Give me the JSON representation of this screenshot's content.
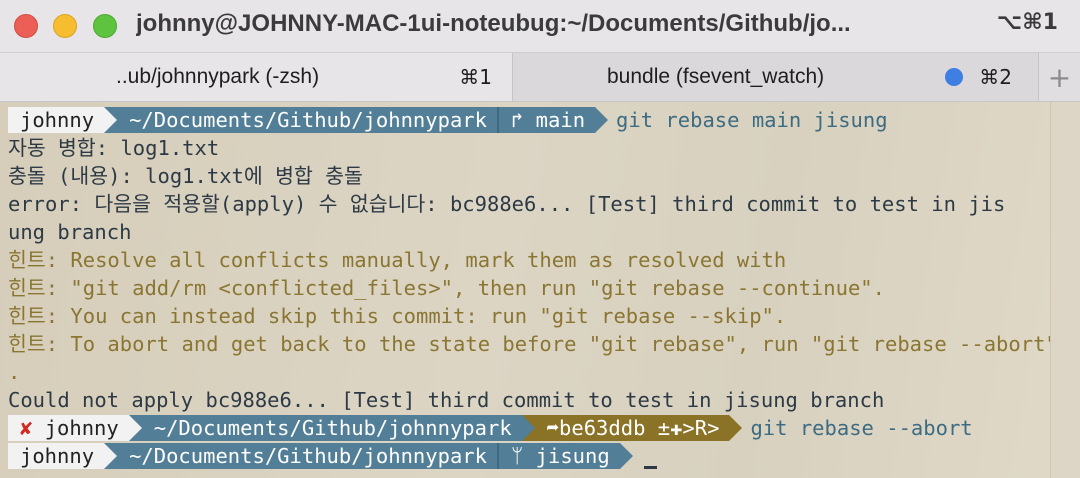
{
  "window": {
    "title": "johnny@JOHNNY-MAC-1ui-noteubug:~/Documents/Github/jo...",
    "shortcut": "⌥⌘1"
  },
  "tabs": [
    {
      "label": "..ub/johnnypark (-zsh)",
      "shortcut": "⌘1",
      "active": true
    },
    {
      "label": "bundle (fsevent_watch)",
      "shortcut": "⌘2",
      "active": false,
      "activity_dot_color": "#3f7fe4"
    }
  ],
  "new_tab_label": "+",
  "colors": {
    "user_segment": "#f2f2f2",
    "dir_segment": "#527f97",
    "rebase_segment": "#8a7327",
    "hint_text": "#8a7632",
    "error_mark": "#d12a20"
  },
  "prompt1": {
    "user": "johnny",
    "dir": "~/Documents/Github/johnnypark",
    "branch": "↱ main",
    "command_git": "git",
    "command_rest": " rebase main jisung"
  },
  "output": [
    {
      "text": "자동 병합: log1.txt",
      "type": "normal"
    },
    {
      "text": "충돌 (내용): log1.txt에 병합 충돌",
      "type": "normal"
    },
    {
      "text": "error: 다음을 적용할(apply) 수 없습니다: bc988e6... [Test] third commit to test in jis",
      "type": "normal"
    },
    {
      "text": "ung branch",
      "type": "normal"
    },
    {
      "text": "힌트: Resolve all conflicts manually, mark them as resolved with",
      "type": "hint"
    },
    {
      "text": "힌트: \"git add/rm <conflicted_files>\", then run \"git rebase --continue\".",
      "type": "hint"
    },
    {
      "text": "힌트: You can instead skip this commit: run \"git rebase --skip\".",
      "type": "hint"
    },
    {
      "text": "힌트: To abort and get back to the state before \"git rebase\", run \"git rebase --abort\"",
      "type": "hint"
    },
    {
      "text": ".",
      "type": "hint"
    },
    {
      "text": "Could not apply bc988e6... [Test] third commit to test in jisung branch",
      "type": "normal"
    }
  ],
  "prompt2": {
    "error_mark": "✘",
    "user": "johnny",
    "dir": "~/Documents/Github/johnnypark",
    "rebase": "➦be63ddb ±✚>R>",
    "command_git": "git",
    "command_rest": " rebase --abort"
  },
  "prompt3": {
    "user": "johnny",
    "dir": "~/Documents/Github/johnnypark",
    "branch": " jisung"
  }
}
